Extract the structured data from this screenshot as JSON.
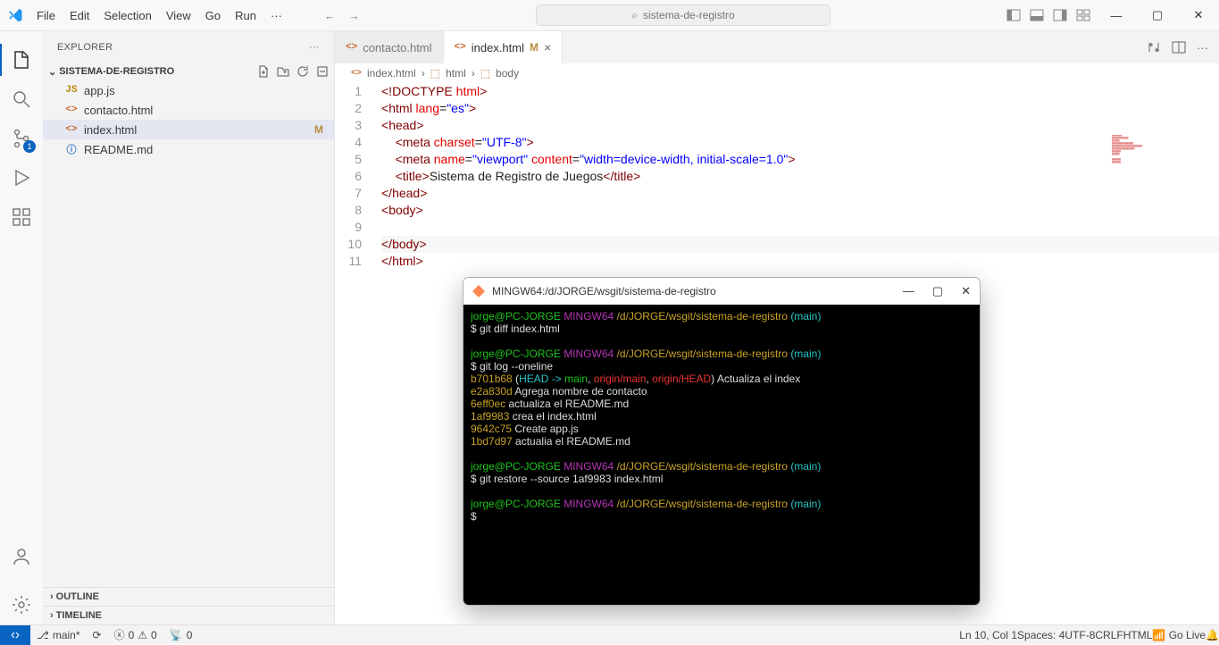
{
  "menu": [
    "File",
    "Edit",
    "Selection",
    "View",
    "Go",
    "Run",
    "···"
  ],
  "search_text": "sistema-de-registro",
  "explorer": {
    "title": "EXPLORER",
    "folder": "SISTEMA-DE-REGISTRO",
    "items": [
      {
        "icon": "JS",
        "cls": "js",
        "name": "app.js",
        "m": ""
      },
      {
        "icon": "<>",
        "cls": "",
        "name": "contacto.html",
        "m": ""
      },
      {
        "icon": "<>",
        "cls": "",
        "name": "index.html",
        "m": "M",
        "sel": true
      },
      {
        "icon": "ⓘ",
        "cls": "md",
        "name": "README.md",
        "m": ""
      }
    ],
    "outline": "OUTLINE",
    "timeline": "TIMELINE"
  },
  "tabs": [
    {
      "icon": "<>",
      "name": "contacto.html",
      "m": "",
      "close": "",
      "active": false
    },
    {
      "icon": "<>",
      "name": "index.html",
      "m": "M",
      "close": "×",
      "active": true
    }
  ],
  "breadcrumb": [
    "index.html",
    "html",
    "body"
  ],
  "code_lines": [
    [
      [
        "tk-p",
        "<!"
      ],
      [
        "tk-doc",
        "DOCTYPE"
      ],
      [
        "tk-txt",
        " "
      ],
      [
        "tk-attr",
        "html"
      ],
      [
        "tk-p",
        ">"
      ]
    ],
    [
      [
        "tk-p",
        "<"
      ],
      [
        "tk-tag",
        "html"
      ],
      [
        "tk-txt",
        " "
      ],
      [
        "tk-attr",
        "lang"
      ],
      [
        "tk-txt",
        "="
      ],
      [
        "tk-str",
        "\"es\""
      ],
      [
        "tk-p",
        ">"
      ]
    ],
    [
      [
        "tk-p",
        "<"
      ],
      [
        "tk-tag",
        "head"
      ],
      [
        "tk-p",
        ">"
      ]
    ],
    [
      [
        "tk-txt",
        "    "
      ],
      [
        "tk-p",
        "<"
      ],
      [
        "tk-tag",
        "meta"
      ],
      [
        "tk-txt",
        " "
      ],
      [
        "tk-attr",
        "charset"
      ],
      [
        "tk-txt",
        "="
      ],
      [
        "tk-str",
        "\"UTF-8\""
      ],
      [
        "tk-p",
        ">"
      ]
    ],
    [
      [
        "tk-txt",
        "    "
      ],
      [
        "tk-p",
        "<"
      ],
      [
        "tk-tag",
        "meta"
      ],
      [
        "tk-txt",
        " "
      ],
      [
        "tk-attr",
        "name"
      ],
      [
        "tk-txt",
        "="
      ],
      [
        "tk-str",
        "\"viewport\""
      ],
      [
        "tk-txt",
        " "
      ],
      [
        "tk-attr",
        "content"
      ],
      [
        "tk-txt",
        "="
      ],
      [
        "tk-str",
        "\"width=device-width, initial-scale=1.0\""
      ],
      [
        "tk-p",
        ">"
      ]
    ],
    [
      [
        "tk-txt",
        "    "
      ],
      [
        "tk-p",
        "<"
      ],
      [
        "tk-tag",
        "title"
      ],
      [
        "tk-p",
        ">"
      ],
      [
        "tk-txt",
        "Sistema de Registro de Juegos"
      ],
      [
        "tk-p",
        "</"
      ],
      [
        "tk-tag",
        "title"
      ],
      [
        "tk-p",
        ">"
      ]
    ],
    [
      [
        "tk-p",
        "</"
      ],
      [
        "tk-tag",
        "head"
      ],
      [
        "tk-p",
        ">"
      ]
    ],
    [
      [
        "tk-p",
        "<"
      ],
      [
        "tk-tag",
        "body"
      ],
      [
        "tk-p",
        ">"
      ]
    ],
    [],
    [
      [
        "tk-p",
        "</"
      ],
      [
        "tk-tag",
        "body"
      ],
      [
        "tk-p",
        ">"
      ]
    ],
    [
      [
        "tk-p",
        "</"
      ],
      [
        "tk-tag",
        "html"
      ],
      [
        "tk-p",
        ">"
      ]
    ]
  ],
  "terminal": {
    "title": "MINGW64:/d/JORGE/wsgit/sistema-de-registro",
    "lines": [
      [
        [
          "tg",
          "jorge@PC-JORGE"
        ],
        [
          "tw",
          " "
        ],
        [
          "tp",
          "MINGW64"
        ],
        [
          "tw",
          " "
        ],
        [
          "ty",
          "/d/JORGE/wsgit/sistema-de-registro"
        ],
        [
          "tw",
          " "
        ],
        [
          "tc",
          "(main)"
        ]
      ],
      [
        [
          "tw",
          "$ git diff index.html"
        ]
      ],
      [
        [
          "tw",
          " "
        ]
      ],
      [
        [
          "tg",
          "jorge@PC-JORGE"
        ],
        [
          "tw",
          " "
        ],
        [
          "tp",
          "MINGW64"
        ],
        [
          "tw",
          " "
        ],
        [
          "ty",
          "/d/JORGE/wsgit/sistema-de-registro"
        ],
        [
          "tw",
          " "
        ],
        [
          "tc",
          "(main)"
        ]
      ],
      [
        [
          "tw",
          "$ git log --oneline"
        ]
      ],
      [
        [
          "ty",
          "b701b68"
        ],
        [
          "tw",
          " ("
        ],
        [
          "tc",
          "HEAD -> "
        ],
        [
          "tg",
          "main"
        ],
        [
          "tw",
          ", "
        ],
        [
          "tr",
          "origin/main"
        ],
        [
          "tw",
          ", "
        ],
        [
          "tr",
          "origin/HEAD"
        ],
        [
          "tw",
          ") Actualiza el index"
        ]
      ],
      [
        [
          "ty",
          "e2a830d"
        ],
        [
          "tw",
          " Agrega nombre de contacto"
        ]
      ],
      [
        [
          "ty",
          "6eff0ec"
        ],
        [
          "tw",
          " actualiza el README.md"
        ]
      ],
      [
        [
          "ty",
          "1af9983"
        ],
        [
          "tw",
          " crea el index.html"
        ]
      ],
      [
        [
          "ty",
          "9642c75"
        ],
        [
          "tw",
          " Create app.js"
        ]
      ],
      [
        [
          "ty",
          "1bd7d97"
        ],
        [
          "tw",
          " actualia el README.md"
        ]
      ],
      [
        [
          "tw",
          " "
        ]
      ],
      [
        [
          "tg",
          "jorge@PC-JORGE"
        ],
        [
          "tw",
          " "
        ],
        [
          "tp",
          "MINGW64"
        ],
        [
          "tw",
          " "
        ],
        [
          "ty",
          "/d/JORGE/wsgit/sistema-de-registro"
        ],
        [
          "tw",
          " "
        ],
        [
          "tc",
          "(main)"
        ]
      ],
      [
        [
          "tw",
          "$ git restore --source 1af9983 index.html"
        ]
      ],
      [
        [
          "tw",
          " "
        ]
      ],
      [
        [
          "tg",
          "jorge@PC-JORGE"
        ],
        [
          "tw",
          " "
        ],
        [
          "tp",
          "MINGW64"
        ],
        [
          "tw",
          " "
        ],
        [
          "ty",
          "/d/JORGE/wsgit/sistema-de-registro"
        ],
        [
          "tw",
          " "
        ],
        [
          "tc",
          "(main)"
        ]
      ],
      [
        [
          "tw",
          "$ "
        ]
      ]
    ]
  },
  "status": {
    "branch": "main*",
    "sync": "",
    "errors": "0",
    "warnings": "0",
    "port": "0",
    "lncol": "Ln 10, Col 1",
    "spaces": "Spaces: 4",
    "enc": "UTF-8",
    "eol": "CRLF",
    "lang": "HTML",
    "golive": "Go Live"
  },
  "scm_badge": "1"
}
